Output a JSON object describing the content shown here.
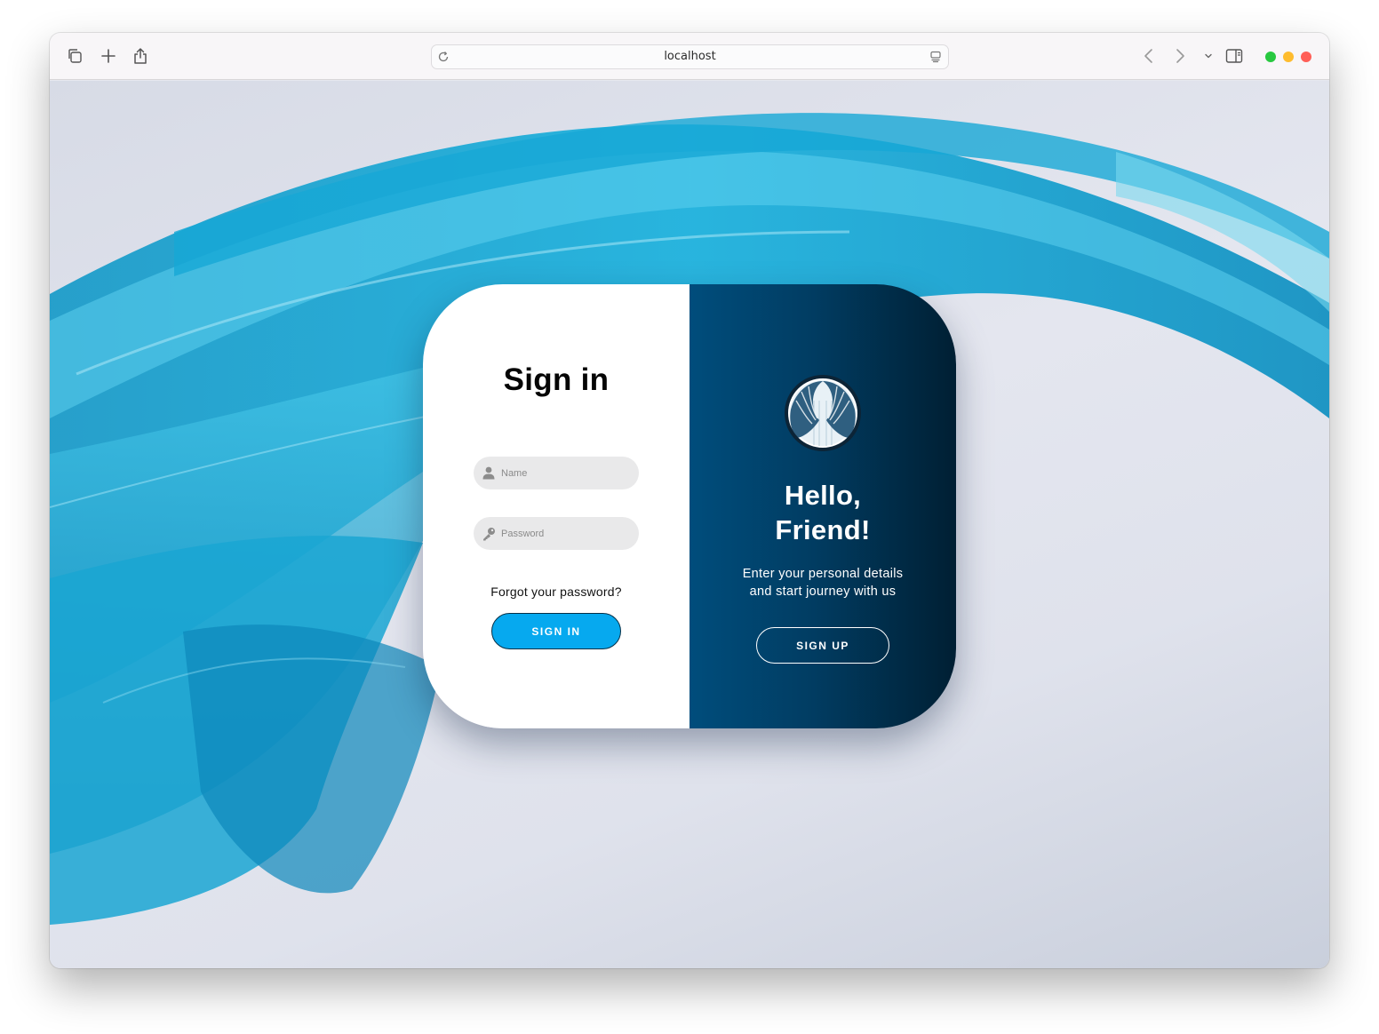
{
  "browser": {
    "url": "localhost",
    "traffic_light_colors": {
      "green": "#28c840",
      "yellow": "#febc2e",
      "red": "#ff5f57"
    },
    "icons": [
      "tabs-overview-icon",
      "new-tab-icon",
      "share-icon",
      "reload-icon",
      "reader-icon",
      "back-icon",
      "forward-icon",
      "chevron-down-icon",
      "sidebar-icon"
    ]
  },
  "signin": {
    "title": "Sign in",
    "name_placeholder": "Name",
    "password_placeholder": "Password",
    "forgot_label": "Forgot your password?",
    "button_label": "SIGN IN",
    "button_color": "#06a9ef",
    "icons": [
      "user-icon",
      "key-icon"
    ]
  },
  "signup_panel": {
    "greeting_line1": "Hello,",
    "greeting_line2": "Friend!",
    "description_line1": "Enter your personal details",
    "description_line2": "and start journey with us",
    "button_label": "SIGN UP",
    "gradient_colors": [
      "#004d7c",
      "#001f33"
    ],
    "icons": [
      "curtain-logo-icon"
    ]
  },
  "background": {
    "accent_color": "#1aa6d2"
  }
}
